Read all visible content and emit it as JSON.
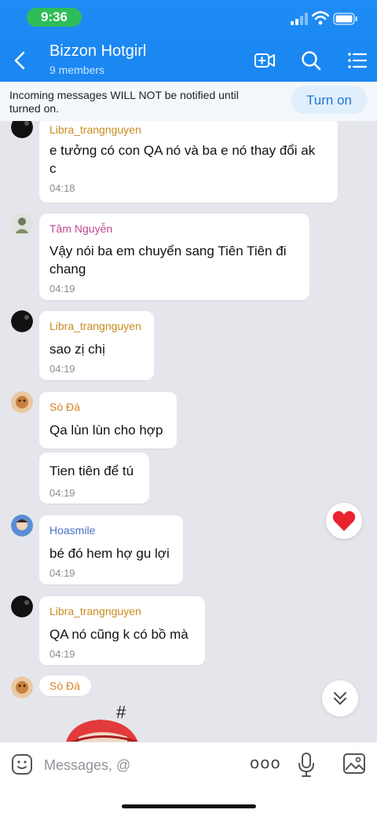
{
  "status_bar": {
    "time": "9:36"
  },
  "header": {
    "title": "Bizzon Hotgirl",
    "subtitle": "9 members"
  },
  "banner": {
    "text": "Incoming messages WILL NOT be notified until turned on.",
    "button": "Turn on"
  },
  "messages": [
    {
      "sender": "Libra_trangnguyen",
      "lines": [
        "e tưởng có con QA nó và ba e nó thay đổi ak",
        "c"
      ],
      "time": "04:18"
    },
    {
      "sender": "Tâm Nguyễn",
      "lines": [
        "Vậy nói ba em chuyển sang Tiên Tiên đi",
        "chang"
      ],
      "time": "04:19"
    },
    {
      "sender": "Libra_trangnguyen",
      "lines": [
        "sao zị chị"
      ],
      "time": "04:19"
    },
    {
      "sender": "Sò Đá",
      "lines": [
        "Qa lùn lùn cho hợp"
      ],
      "time": ""
    },
    {
      "sender": "",
      "lines": [
        "Tien tiên để tú"
      ],
      "time": "04:19"
    },
    {
      "sender": "Hoasmile",
      "lines": [
        "bé đó hem hợ gu lợi"
      ],
      "time": "04:19"
    },
    {
      "sender": "Libra_trangnguyen",
      "lines": [
        "QA nó cũng k có bồ mà"
      ],
      "time": "04:19"
    },
    {
      "sender": "Sò Đá",
      "lines": [],
      "time": ""
    }
  ],
  "sticker": {
    "symbol": "#"
  },
  "input": {
    "placeholder": "Messages, @",
    "more": "ooo"
  },
  "colors": {
    "header": "#1a86f1",
    "libra": "#c98a1e",
    "tam": "#c0478e",
    "soda": "#d6822a",
    "hoasmile": "#4a6fc7"
  }
}
